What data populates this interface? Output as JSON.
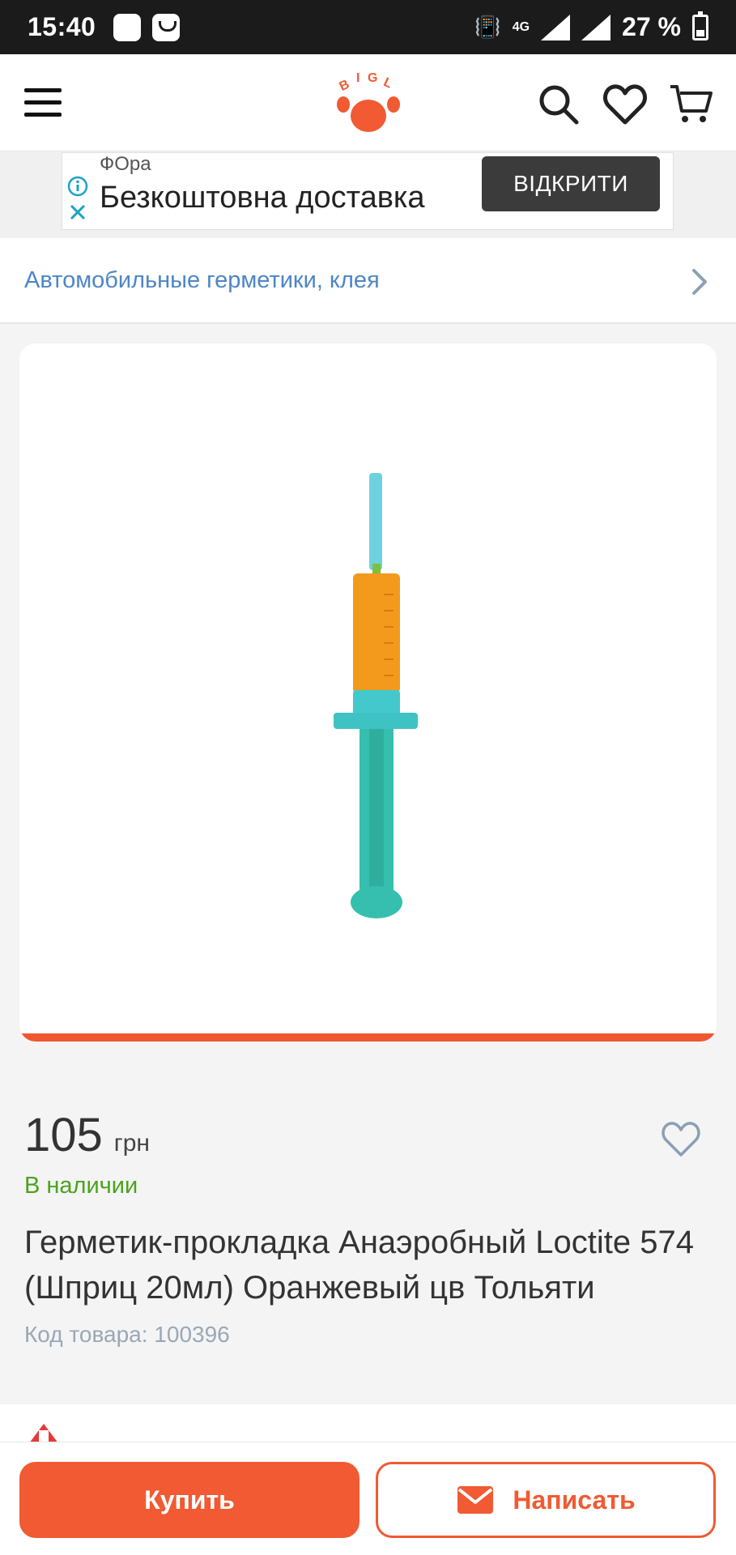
{
  "status_bar": {
    "time": "15:40",
    "network": "4G",
    "battery": "27 %"
  },
  "header": {
    "logo_text": "BIGL"
  },
  "ad": {
    "brand": "ФОра",
    "title": "Безкоштовна доставка",
    "button": "ВІДКРИТИ"
  },
  "category": {
    "label": "Автомобильные герметики, клея"
  },
  "product": {
    "price": "105",
    "currency": "грн",
    "stock": "В наличии",
    "title": "Герметик-прокладка Анаэробный Loctite 574 (Шприц 20мл) Оранжевый цв Тольяти",
    "code": "Код товара: 100396"
  },
  "actions": {
    "buy": "Купить",
    "write": "Написать"
  },
  "colors": {
    "accent": "#f15a32",
    "link": "#4d86c6",
    "in_stock": "#4aa31c"
  }
}
